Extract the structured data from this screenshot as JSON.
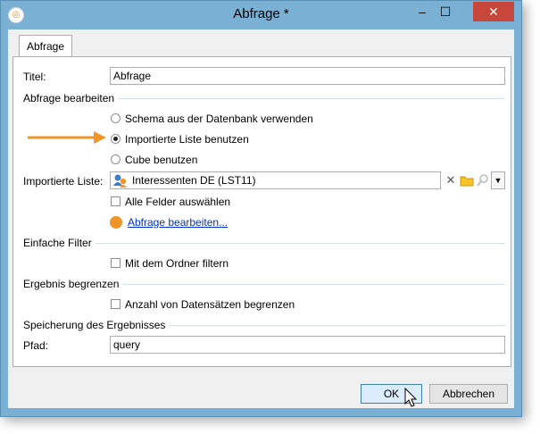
{
  "window": {
    "title": "Abfrage *",
    "app_icon": "app-icon",
    "controls": {
      "minimize": "–",
      "maximize": "☐",
      "close": "✕"
    }
  },
  "tab": {
    "label": "Abfrage"
  },
  "form": {
    "title_label": "Titel:",
    "title_value": "Abfrage",
    "section_edit": "Abfrage bearbeiten",
    "radio_schema": "Schema aus der Datenbank verwenden",
    "radio_imported": "Importierte Liste benutzen",
    "radio_cube": "Cube benutzen",
    "selected_radio": "radio_imported",
    "imported_list_label": "Importierte Liste:",
    "imported_list_value": "Interessenten DE (LST11)",
    "checkbox_all_fields": "Alle Felder auswählen",
    "edit_query_link": "Abfrage bearbeiten...",
    "section_simple_filter": "Einfache Filter",
    "checkbox_folder_filter": "Mit dem Ordner filtern",
    "section_limit": "Ergebnis begrenzen",
    "checkbox_limit_records": "Anzahl von Datensätzen begrenzen",
    "section_storage": "Speicherung des Ergebnisses",
    "path_label": "Pfad:",
    "path_value": "query"
  },
  "buttons": {
    "ok": "OK",
    "cancel": "Abbrechen"
  },
  "colors": {
    "accent_orange": "#f0952a",
    "title_bar": "#7ab0d4",
    "close_red": "#c7473a",
    "link": "#0033cc"
  }
}
